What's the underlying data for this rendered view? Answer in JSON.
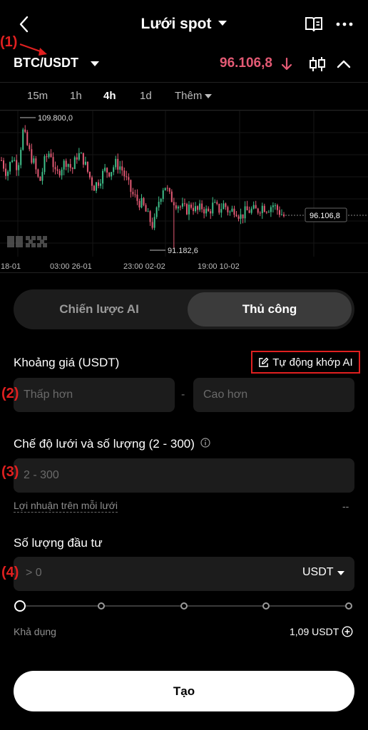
{
  "header": {
    "title": "Lưới spot",
    "back_icon": "chevron-left-icon",
    "guide_icon": "book-icon",
    "more_icon": "more-horizontal-icon"
  },
  "annotations": [
    "(1)",
    "(2)",
    "(3)",
    "(4)"
  ],
  "pair": {
    "name": "BTC/USDT",
    "price": "96.106,8",
    "price_color": "#e35a74"
  },
  "timeframes": [
    "15m",
    "1h",
    "4h",
    "1d",
    "Thêm"
  ],
  "active_timeframe": "4h",
  "chart": {
    "high_label": "109.800,0",
    "low_label": "91.182,6",
    "current_label": "96.106,8",
    "watermark": "OKX",
    "x_labels": [
      "18-01",
      "03:00 26-01",
      "23:00 02-02",
      "19:00 10-02"
    ],
    "up_color": "#3fbf8a",
    "down_color": "#e35a74"
  },
  "chart_data": {
    "type": "candlestick",
    "title": "",
    "x_ticks": [
      "18-01",
      "03:00 26-01",
      "23:00 02-02",
      "19:00 10-02"
    ],
    "ylim": [
      90000,
      112000
    ],
    "high": 109800.0,
    "low": 91182.6,
    "last": 96106.8,
    "close_path": [
      104500,
      102500,
      105000,
      103500,
      109000,
      106000,
      104000,
      101000,
      104500,
      106000,
      102000,
      103500,
      104500,
      103000,
      105500,
      104800,
      102500,
      100500,
      101500,
      103000,
      102800,
      104000,
      103500,
      101500,
      99500,
      98500,
      97800,
      96000,
      94500,
      98500,
      101000,
      99000,
      98200,
      97500,
      97000,
      97800,
      96800,
      97500,
      96500,
      97800,
      97000,
      97900,
      96600,
      97300,
      96000,
      96800,
      97000,
      96900,
      97600,
      97300,
      97800,
      96900,
      96100
    ]
  },
  "mode": {
    "options": [
      "Chiến lược AI",
      "Thủ công"
    ],
    "active": "Thủ công"
  },
  "price_range": {
    "label": "Khoảng giá (USDT)",
    "ai_button": "Tự động khớp AI",
    "ai_icon": "edit-icon",
    "lower_placeholder": "Thấp hơn",
    "separator": "-",
    "upper_placeholder": "Cao hơn"
  },
  "grid": {
    "label": "Chế độ lưới và số lượng (2 - 300)",
    "info_icon": "info-icon",
    "placeholder": "2 - 300",
    "profit_label": "Lợi nhuận trên mỗi lưới",
    "profit_value": "--"
  },
  "investment": {
    "label": "Số lượng đầu tư",
    "placeholder": "> 0",
    "currency": "USDT",
    "slider_value": 0,
    "available_label": "Khả dụng",
    "available_value": "1,09 USDT",
    "add_icon": "plus-circle-icon"
  },
  "create_button": "Tạo",
  "annotation_color": "#e02020"
}
